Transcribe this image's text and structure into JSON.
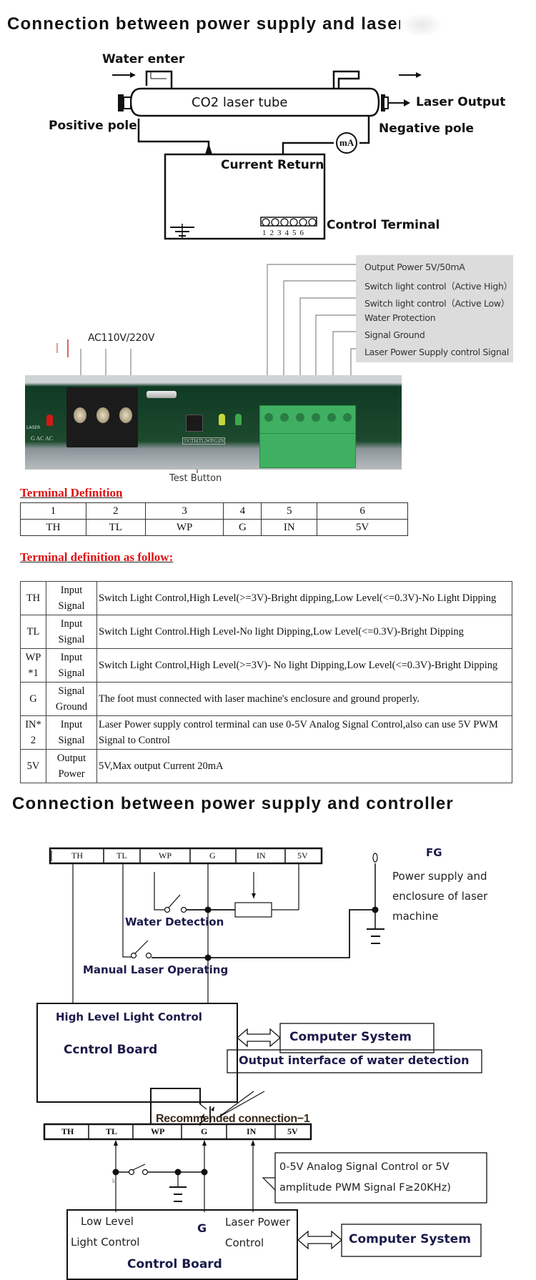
{
  "section1": {
    "title": "Connection between  power supply and laser",
    "labels": {
      "water_enter": "Water enter",
      "tube": "CO2 laser tube",
      "laser_output": "Laser Output",
      "positive_pole": "Positive pole",
      "negative_pole": "Negative pole",
      "meter": "mA",
      "current_return": "Current Return",
      "control_terminal": "Control Terminal",
      "terminal_numbers": [
        "1",
        "2",
        "3",
        "4",
        "5",
        "6"
      ]
    }
  },
  "section2": {
    "ac_label": "AC110V/220V",
    "test_button": "Test Button",
    "callouts": [
      "Output Power 5V/50mA",
      "Switch light control（Active High）",
      "Switch light control（Active Low）",
      "Water Protection",
      "Signal Ground",
      "Laser Power Supply control Signal"
    ],
    "board_print": [
      "G",
      "AC",
      "AC",
      "LASER",
      "5V",
      "TH",
      "TL",
      "WP",
      "G",
      "IN",
      "WP",
      "TL"
    ]
  },
  "terminal_definition": {
    "title": "Terminal Definition",
    "numbers": [
      "1",
      "2",
      "3",
      "4",
      "5",
      "6"
    ],
    "names": [
      "TH",
      "TL",
      "WP",
      "G",
      "IN",
      "5V"
    ]
  },
  "terminal_detail": {
    "title": "Terminal definition as follow:",
    "rows": [
      {
        "pin": "TH",
        "type": "Input Signal",
        "desc": "Switch Light Control,High Level(>=3V)-Bright dipping,Low Level(<=0.3V)-No Light Dipping"
      },
      {
        "pin": "TL",
        "type": "Input Signal",
        "desc": "Switch Light Control.High Level-No light Dipping,Low Level(<=0.3V)-Bright Dipping"
      },
      {
        "pin": "WP *1",
        "type": "Input Signal",
        "desc": "Switch Light Control,High Level(>=3V)- No light Dipping,Low Level(<=0.3V)-Bright Dipping"
      },
      {
        "pin": "G",
        "type": "Signal Ground",
        "desc": "The foot must connected with laser machine's enclosure and ground properly."
      },
      {
        "pin": "IN* 2",
        "type": "Input Signal",
        "desc": "Laser Power supply control terminal can use 0-5V Analog Signal Control,also can use 5V PWM Signal to Control"
      },
      {
        "pin": "5V",
        "type": "Output Power",
        "desc": "5V,Max output Current 20mA"
      }
    ]
  },
  "section3": {
    "title": "Connection between  power supply and controller",
    "terminals": [
      "TH",
      "TL",
      "WP",
      "G",
      "IN",
      "5V"
    ],
    "fg": "FG",
    "fg_desc": [
      "Power supply and",
      "enclosure of laser",
      "machine"
    ],
    "water_detection": "Water Detection",
    "manual_laser": "Manual Laser Operating",
    "high_level": "High Level Light Control",
    "control_board": "Ccntrol Board",
    "computer": "Computer System",
    "caption": "Recommended connection−1"
  },
  "section4": {
    "output_interface": "Output interface of water detection",
    "terminals": [
      "TH",
      "TL",
      "WP",
      "G",
      "IN",
      "5V"
    ],
    "small_label": "la",
    "signal_note": [
      "0-5V Analog Signal Control or 5V",
      "amplitude PWM Signal F≥20KHz)"
    ],
    "low_level": [
      "Low Level",
      "Light Control"
    ],
    "g_label": "G",
    "laser_power": [
      "Laser Power",
      "Control"
    ],
    "control_board": "Control Board",
    "computer": "Computer System"
  }
}
